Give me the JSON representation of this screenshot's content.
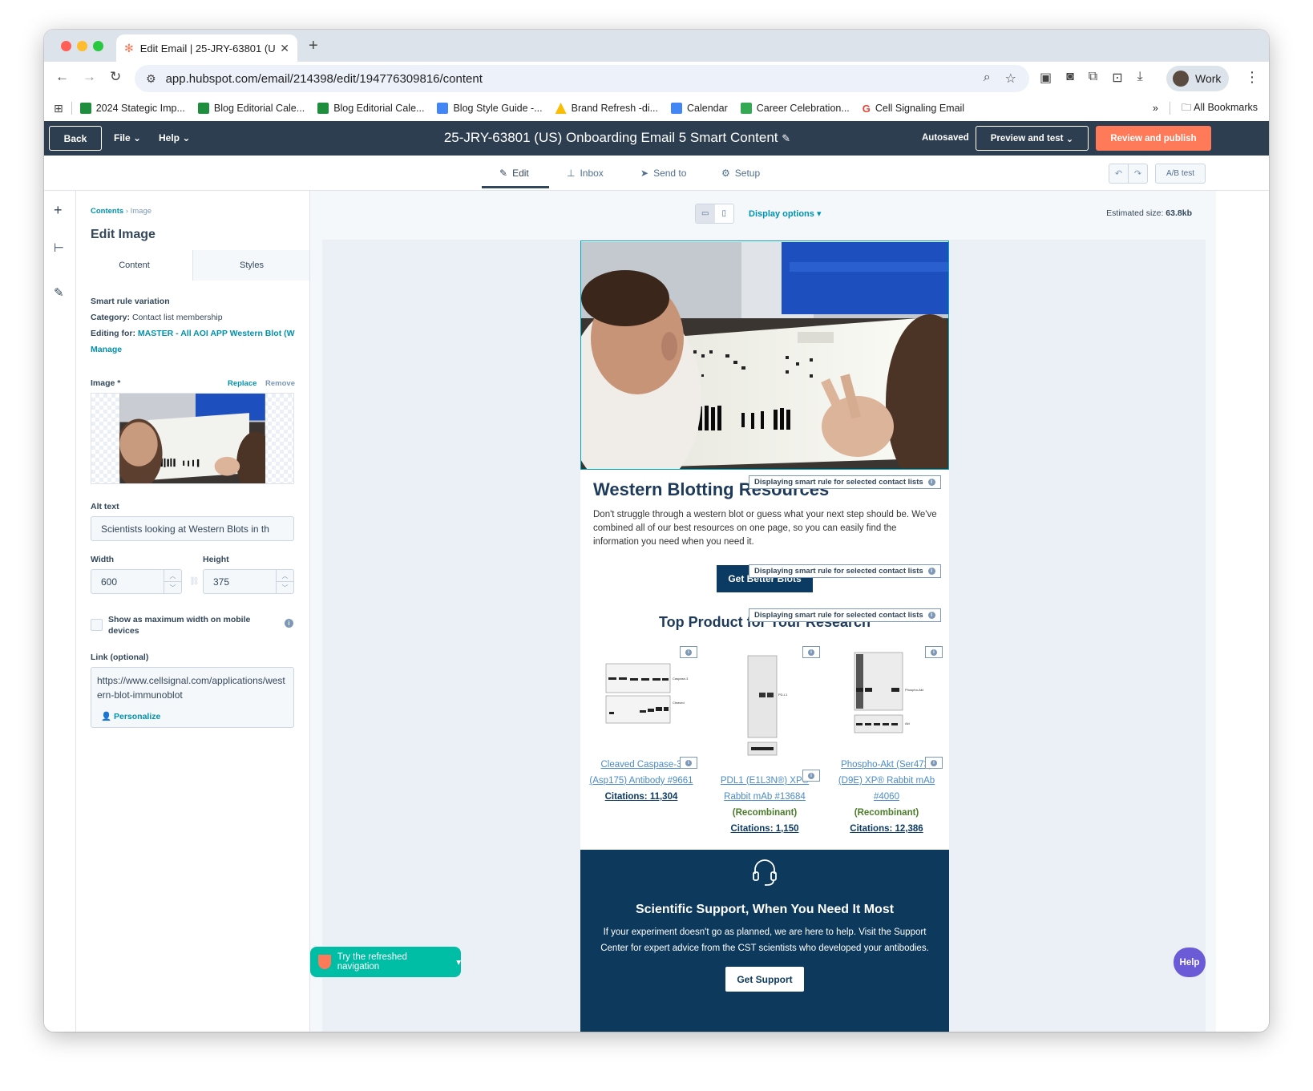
{
  "browser": {
    "tab_title": "Edit Email | 25-JRY-63801 (U",
    "url": "app.hubspot.com/email/214398/edit/194776309816/content",
    "profile_label": "Work",
    "bookmarks": [
      {
        "label": "2024 Stategic Imp...",
        "color": "#1e8e3e"
      },
      {
        "label": "Blog Editorial Cale...",
        "color": "#1e8e3e"
      },
      {
        "label": "Blog Editorial Cale...",
        "color": "#1e8e3e"
      },
      {
        "label": "Blog Style Guide -...",
        "color": "#4285f4"
      },
      {
        "label": "Brand Refresh -di...",
        "color": "#fbbc04"
      },
      {
        "label": "Calendar",
        "color": "#4285f4"
      },
      {
        "label": "Career Celebration...",
        "color": "#34a853"
      },
      {
        "label": "Cell Signaling Email",
        "color": "#ea4335"
      }
    ],
    "all_bookmarks": "All Bookmarks"
  },
  "hubspot": {
    "back": "Back",
    "file_menu": "File",
    "help_menu": "Help",
    "email_title": "25-JRY-63801 (US) Onboarding Email 5 Smart Content",
    "autosaved": "Autosaved",
    "preview": "Preview and test",
    "publish": "Review and publish",
    "tabs": [
      "Edit",
      "Inbox",
      "Send to",
      "Setup"
    ],
    "ab_test": "A/B test"
  },
  "sidebar": {
    "crumb_root": "Contents",
    "crumb_current": "Image",
    "title": "Edit Image",
    "tab_content": "Content",
    "tab_styles": "Styles",
    "smart_rule": "Smart rule variation",
    "category_label": "Category:",
    "category_value": "Contact list membership",
    "editing_label": "Editing for:",
    "editing_value": "MASTER - All AOI APP Western Blot (W",
    "manage": "Manage",
    "image_label": "Image *",
    "replace": "Replace",
    "remove": "Remove",
    "alt_label": "Alt text",
    "alt_value": "Scientists looking at Western Blots in th",
    "width_label": "Width",
    "width_value": "600",
    "height_label": "Height",
    "height_value": "375",
    "mobile_label": "Show as maximum width on mobile devices",
    "link_label": "Link (optional)",
    "link_value": "https://www.cellsignal.com/applications/western-blot-immunoblot",
    "personalize": "Personalize"
  },
  "canvas": {
    "display_options": "Display options",
    "est_label": "Estimated size:",
    "est_value": "63.8kb",
    "smart_badge": "Displaying smart rule for selected contact lists",
    "wb_title": "Western Blotting Resources",
    "wb_body": "Don't struggle through a western blot or guess what your next step should be. We've combined all of our best resources on one page, so you can easily find the information you need when you need it.",
    "cta": "Get Better Blots",
    "top_products": "Top Product for Your Research",
    "products": [
      {
        "name": "Cleaved Caspase-3 (Asp175) Antibody #9661",
        "recomb": "",
        "cites": "Citations: 11,304"
      },
      {
        "name": "PDL1 (E1L3N®) XP® Rabbit mAb #13684",
        "recomb": "(Recombinant)",
        "cites": "Citations: 1,150"
      },
      {
        "name": "Phospho-Akt (Ser473) (D9E) XP® Rabbit mAb #4060",
        "recomb": "(Recombinant)",
        "cites": "Citations: 12,386"
      }
    ],
    "support_title": "Scientific Support, When You Need It Most",
    "support_body": "If your experiment doesn't go as planned, we are here to help. Visit the Support Center for expert advice from the CST scientists who developed your antibodies.",
    "support_btn": "Get Support"
  },
  "try_nav": "Try the refreshed navigation",
  "help": "Help"
}
